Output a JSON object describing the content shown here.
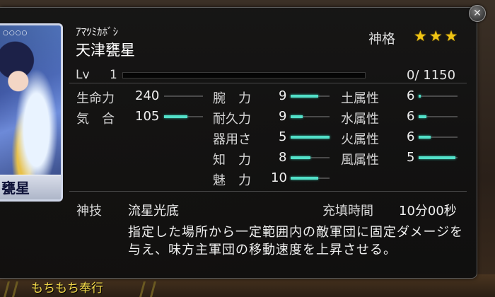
{
  "scene": {
    "caption": "もちもち奉行"
  },
  "card": {
    "name": "甕星",
    "dots": "○○○○"
  },
  "header": {
    "kana": "ｱﾏﾂﾐｶﾎﾞｼ",
    "name": "天津甕星",
    "rank_label": "神格",
    "stars": "★★★",
    "rank": 3,
    "rank_max": 3
  },
  "level": {
    "label": "Lv",
    "value": "1",
    "exp_current": 0,
    "exp_max": 1150,
    "exp_text": "0/ 1150"
  },
  "stats": [
    {
      "key": "life",
      "label": "生命力",
      "value": "240",
      "fill": 0.0
    },
    {
      "key": "spirit",
      "label": "気　合",
      "value": "105",
      "fill": 0.6
    },
    {
      "key": "arm",
      "label": "腕　力",
      "value": "9",
      "fill": 0.7
    },
    {
      "key": "endure",
      "label": "耐久力",
      "value": "9",
      "fill": 0.3
    },
    {
      "key": "dex",
      "label": "器用さ",
      "value": "5",
      "fill": 1.0
    },
    {
      "key": "int",
      "label": "知　力",
      "value": "8",
      "fill": 0.5
    },
    {
      "key": "charm",
      "label": "魅　力",
      "value": "10",
      "fill": 0.7
    },
    {
      "key": "earth",
      "label": "土属性",
      "value": "6",
      "fill": 0.05
    },
    {
      "key": "water",
      "label": "水属性",
      "value": "6",
      "fill": 0.2
    },
    {
      "key": "fire",
      "label": "火属性",
      "value": "6",
      "fill": 0.3
    },
    {
      "key": "wind",
      "label": "風属性",
      "value": "5",
      "fill": 0.95
    }
  ],
  "skill": {
    "label": "神技",
    "name": "流星光底",
    "charge_label": "充填時間",
    "charge_value": "10分00秒",
    "description": "指定した場所から一定範囲内の敵軍団に固定ダメージを与え、味方主軍団の移動速度を上昇させる。"
  },
  "controls": {
    "close_glyph": "✕"
  },
  "colors": {
    "bar": "#52e0c8",
    "star": "#f0c514",
    "caption": "#f3d94a"
  }
}
